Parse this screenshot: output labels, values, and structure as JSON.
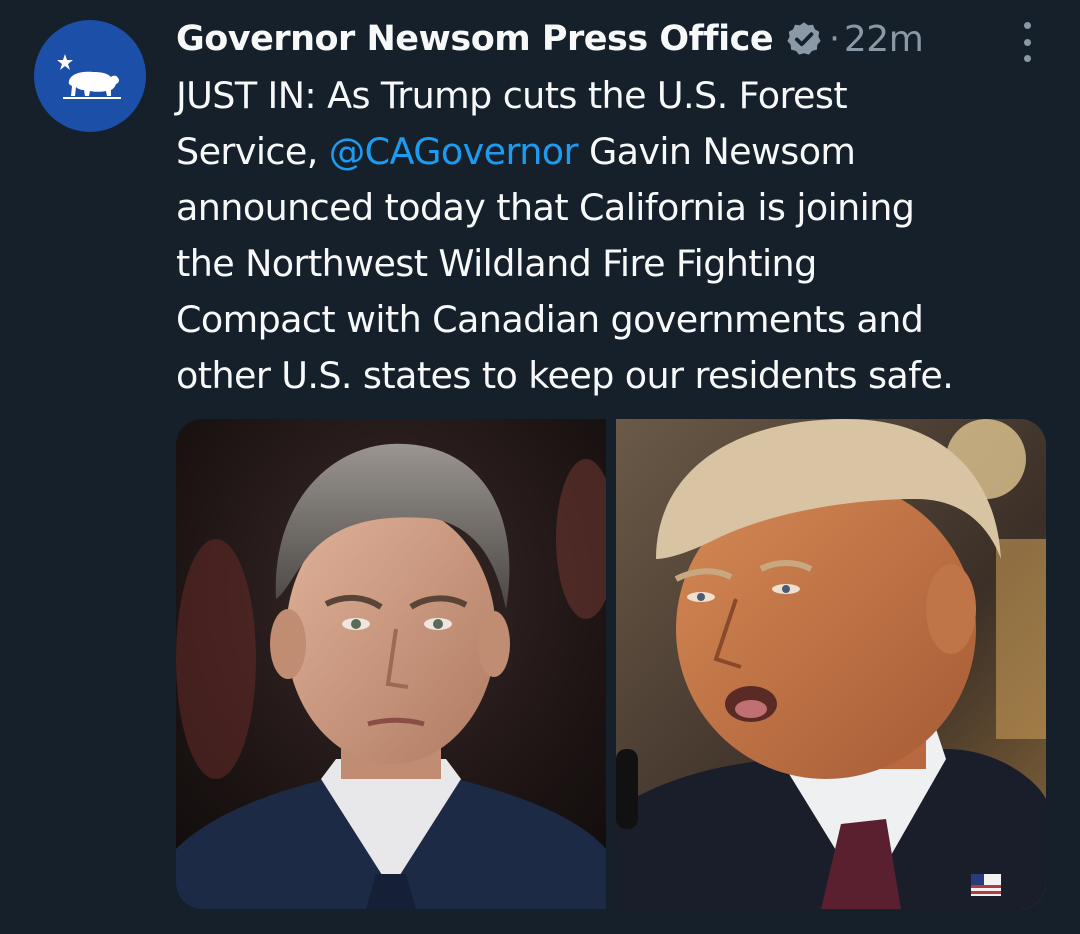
{
  "tweet": {
    "author": {
      "display_name": "Governor Newsom Press Office",
      "verified_icon": "verified-badge-icon",
      "avatar_icon": "california-bear-icon",
      "avatar_color": "#1c4fa8"
    },
    "separator": "·",
    "timestamp": "22m",
    "menu_icon": "more-vertical-icon",
    "text": {
      "line1": "JUST IN: As Trump cuts the U.S. Forest",
      "line2_before": "Service, ",
      "mention": "@CAGovernor",
      "line2_after": " Gavin Newsom",
      "line3": "announced today that California is joining",
      "line4": "the Northwest Wildland Fire Fighting",
      "line5": "Compact with Canadian governments and",
      "line6": "other U.S. states to keep our residents safe."
    },
    "media": [
      {
        "kind": "photo",
        "subject": "man-in-suit-portrait-left"
      },
      {
        "kind": "photo",
        "subject": "man-in-suit-speaking-right"
      }
    ]
  },
  "colors": {
    "background": "#15202b",
    "text": "#f7f9f9",
    "secondary": "#8b98a5",
    "link": "#1d9bf0"
  }
}
